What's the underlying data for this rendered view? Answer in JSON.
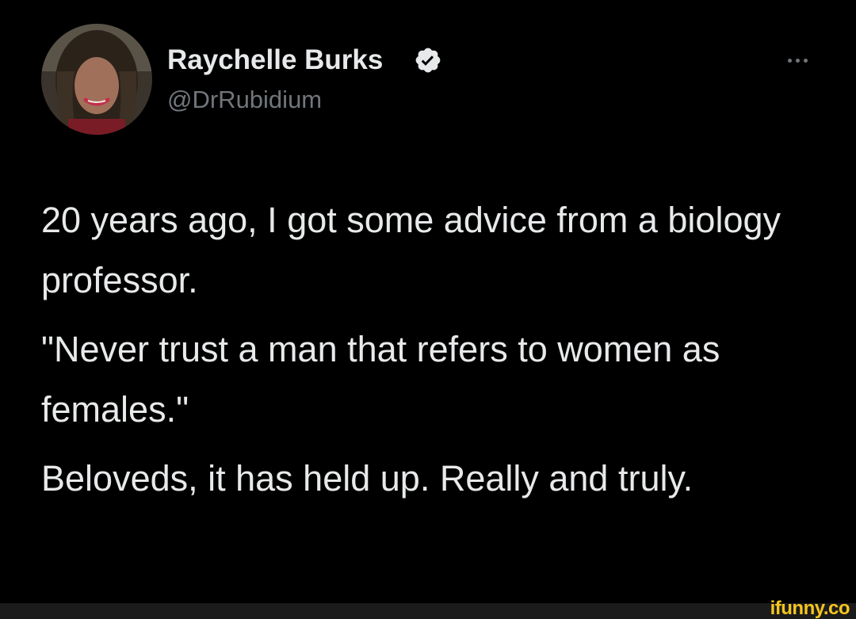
{
  "author": {
    "display_name": "Raychelle Burks",
    "handle": "@DrRubidium",
    "verified": true,
    "verified_color": "#e7e9ea",
    "avatar_icon": "profile-photo"
  },
  "more_menu": {
    "icon": "more-horizontal-icon"
  },
  "tweet": {
    "paragraphs": [
      "20 years ago, I got some advice from a biology professor.",
      "\"Never trust a man that refers to women as females.\"",
      "Beloveds, it has held up. Really and truly."
    ]
  },
  "watermark": {
    "text": "ifunny.co",
    "color": "#f5c51d"
  },
  "colors": {
    "background": "#000000",
    "text_primary": "#e7e9ea",
    "text_secondary": "#71767b"
  }
}
